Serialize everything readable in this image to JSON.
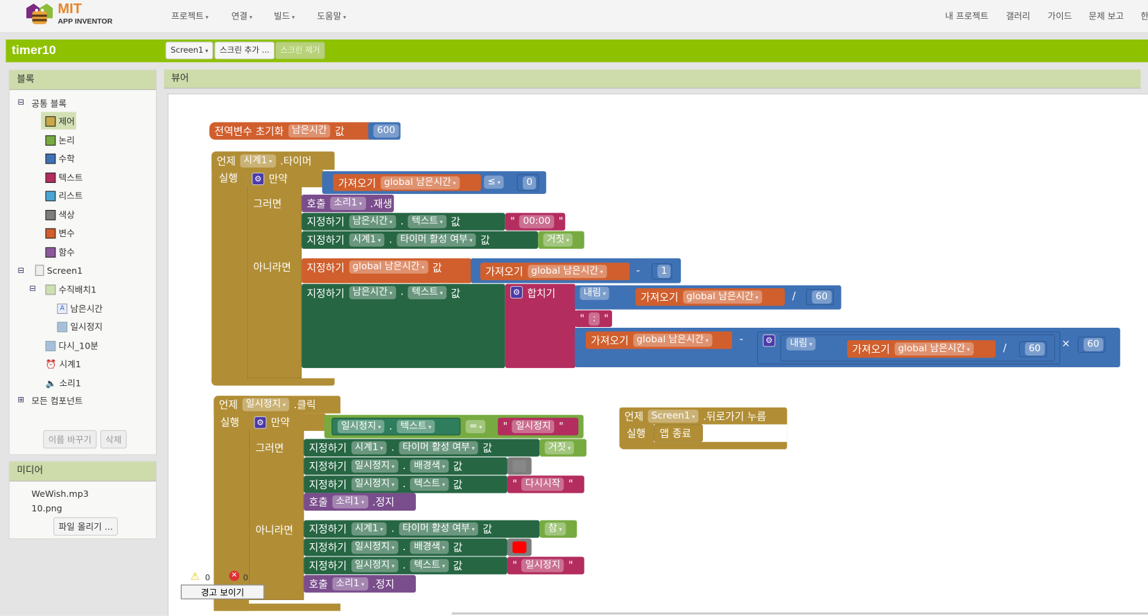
{
  "header": {
    "logo_top": "MIT",
    "logo_bottom": "APP INVENTOR",
    "menus": [
      "프로젝트",
      "연결",
      "빌드",
      "도움말"
    ],
    "right_links": [
      "내 프로젝트",
      "갤러리",
      "가이드",
      "문제 보고",
      "한"
    ]
  },
  "project": {
    "title": "timer10",
    "screen_select": "Screen1",
    "add_screen": "스크린 추가 ...",
    "remove_screen": "스크린 제거"
  },
  "blocks_panel": {
    "title": "블록",
    "builtin": "공통 블록",
    "categories": [
      {
        "label": "제어",
        "color": "#c8a94a"
      },
      {
        "label": "논리",
        "color": "#77ab41"
      },
      {
        "label": "수학",
        "color": "#3f71b5"
      },
      {
        "label": "텍스트",
        "color": "#b32d5e"
      },
      {
        "label": "리스트",
        "color": "#49a6d4"
      },
      {
        "label": "색상",
        "color": "#7d7d7d"
      },
      {
        "label": "변수",
        "color": "#d05f2d"
      },
      {
        "label": "함수",
        "color": "#8e5a9e"
      }
    ],
    "components": {
      "screen": "Screen1",
      "arrangement": "수직배치1",
      "label": "남은시간",
      "button": "일시정지",
      "button2": "다시_10분",
      "clock": "시계1",
      "sound": "소리1"
    },
    "all_components": "모든 컴포넌트",
    "rename": "이름 바꾸기",
    "delete": "삭제"
  },
  "media": {
    "title": "미디어",
    "files": [
      "WeWish.mp3",
      "10.png"
    ],
    "upload": "파일 올리기 ..."
  },
  "viewer": {
    "title": "뷰어"
  },
  "kw": {
    "init": "전역변수 초기화",
    "val": "값",
    "when": "언제",
    "do": "실행",
    "if": "만약",
    "then": "그러면",
    "else": "아니라면",
    "get": "가져오기",
    "set": "지정하기",
    "call": "호출",
    "join": "합치기",
    "floor": "내림",
    "dot": ".",
    "minus": "-",
    "div": "/",
    "times": "×",
    "le": "≤",
    "eq": "=",
    "q": "\"",
    "timer_evt": ".타이머",
    "click_evt": ".클릭",
    "back_evt": ".뒤로가기 누름",
    "play": ".재생",
    "stop": ".정지",
    "quit": "앱 종료"
  },
  "names": {
    "var": "남은시간",
    "gvar": "global 남은시간",
    "clock": "시계1",
    "sound": "소리1",
    "label": "남은시간",
    "button": "일시정지",
    "screen": "Screen1",
    "text": "텍스트",
    "timer_enabled": "타이머 활성 여부",
    "bgcolor": "배경색"
  },
  "values": {
    "init": "600",
    "zero": "0",
    "one": "1",
    "sixty": "60",
    "time_zero": "00:00",
    "colon": ":",
    "false": "거짓",
    "true": "참",
    "pause": "일시정지",
    "restart": "다시시작",
    "gray": "#888888",
    "red": "#ff0000"
  },
  "status": {
    "warnings": "0",
    "errors": "0",
    "show_warnings": "경고 보이기"
  }
}
